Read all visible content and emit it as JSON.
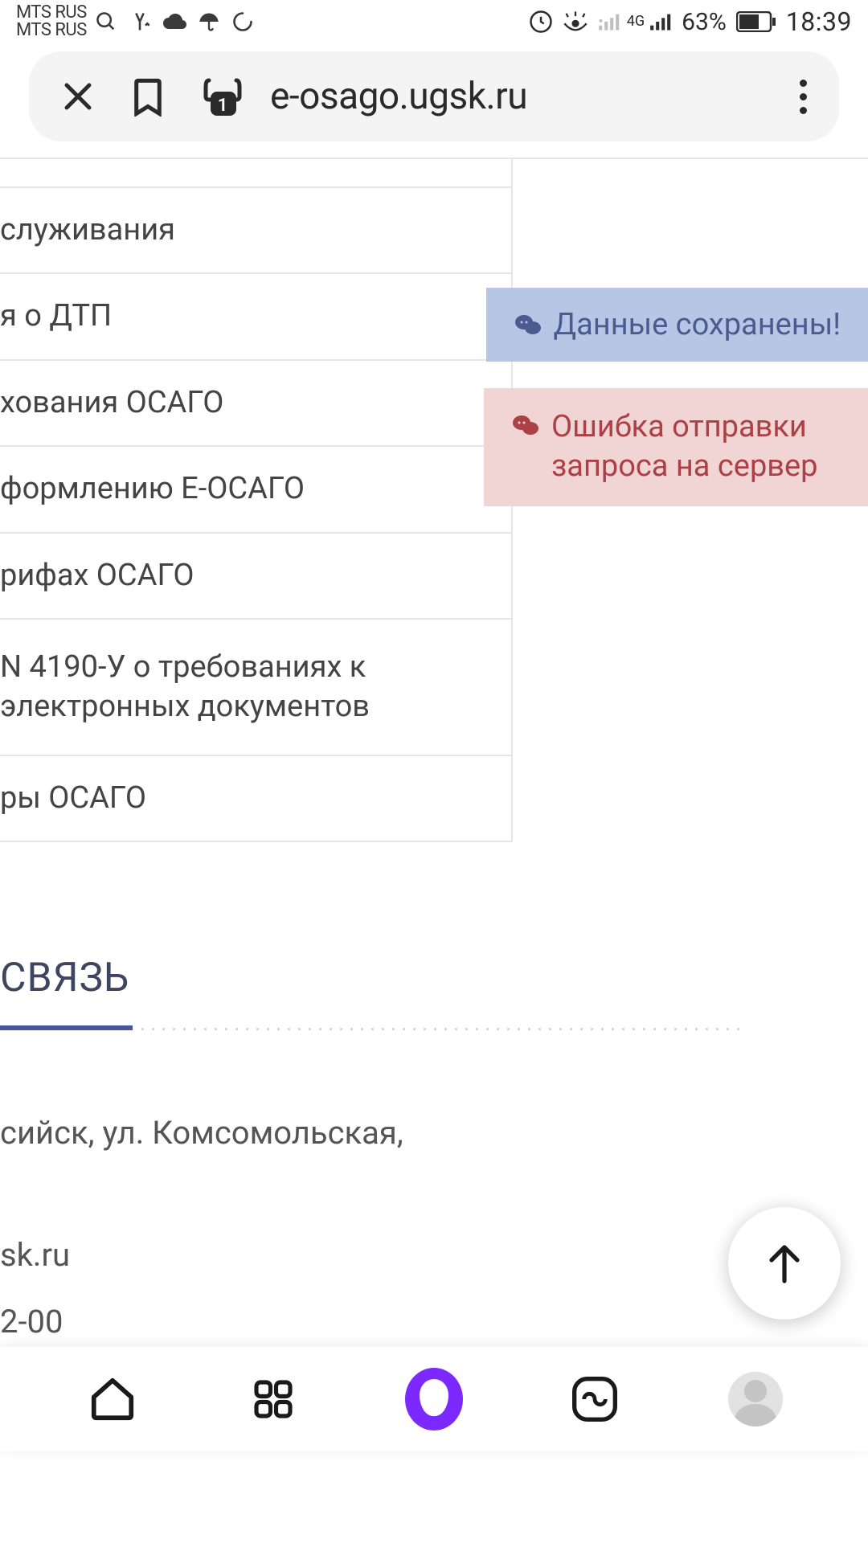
{
  "status": {
    "carrier1": "MTS RUS",
    "carrier2": "MTS RUS",
    "network": "4G",
    "battery": "63%",
    "time": "18:39"
  },
  "browser": {
    "url": "e-osago.ugsk.ru",
    "tab_badge": "1"
  },
  "list": {
    "items": [
      "служивания",
      "я о ДТП",
      "хования ОСАГО",
      "формлению Е-ОСАГО",
      "рифах ОСАГО",
      "N 4190-У о требованиях к электронных документов",
      "ры ОСАГО"
    ]
  },
  "toasts": {
    "info": "Данные сохранены!",
    "error": "Ошибка отправки запроса на сервер"
  },
  "footer": {
    "title": "СВЯЗЬ",
    "address": "сийск, ул. Комсомольская,",
    "email": "sk.ru",
    "phone": "2-00"
  }
}
